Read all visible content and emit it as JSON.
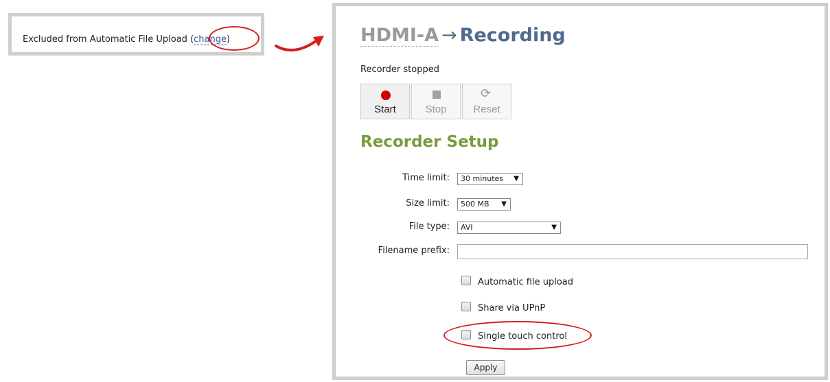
{
  "callout": {
    "text_prefix": "Excluded from Automatic File Upload (",
    "change_link": "change",
    "text_suffix": ")"
  },
  "breadcrumb": {
    "parent": "HDMI-A",
    "separator": "→",
    "current": "Recording"
  },
  "status": "Recorder stopped",
  "recorder_buttons": [
    {
      "label": "Start",
      "icon": "record-dot-icon",
      "enabled": true
    },
    {
      "label": "Stop",
      "icon": "stop-square-icon",
      "enabled": false
    },
    {
      "label": "Reset",
      "icon": "refresh-icon",
      "enabled": false
    }
  ],
  "setup": {
    "title": "Recorder Setup",
    "time_limit": {
      "label": "Time limit:",
      "value": "30 minutes"
    },
    "size_limit": {
      "label": "Size limit:",
      "value": "500 MB"
    },
    "file_type": {
      "label": "File type:",
      "value": "AVI"
    },
    "filename_prefix": {
      "label": "Filename prefix:",
      "value": ""
    },
    "checkboxes": [
      {
        "label": "Automatic file upload",
        "checked": false
      },
      {
        "label": "Share via UPnP",
        "checked": false
      },
      {
        "label": "Single touch control",
        "checked": false
      }
    ],
    "apply_label": "Apply"
  },
  "colors": {
    "highlight_circle": "#d31f1f",
    "section_title": "#7a9b3e",
    "breadcrumb_current": "#506a8f",
    "record_dot": "#d10000"
  }
}
